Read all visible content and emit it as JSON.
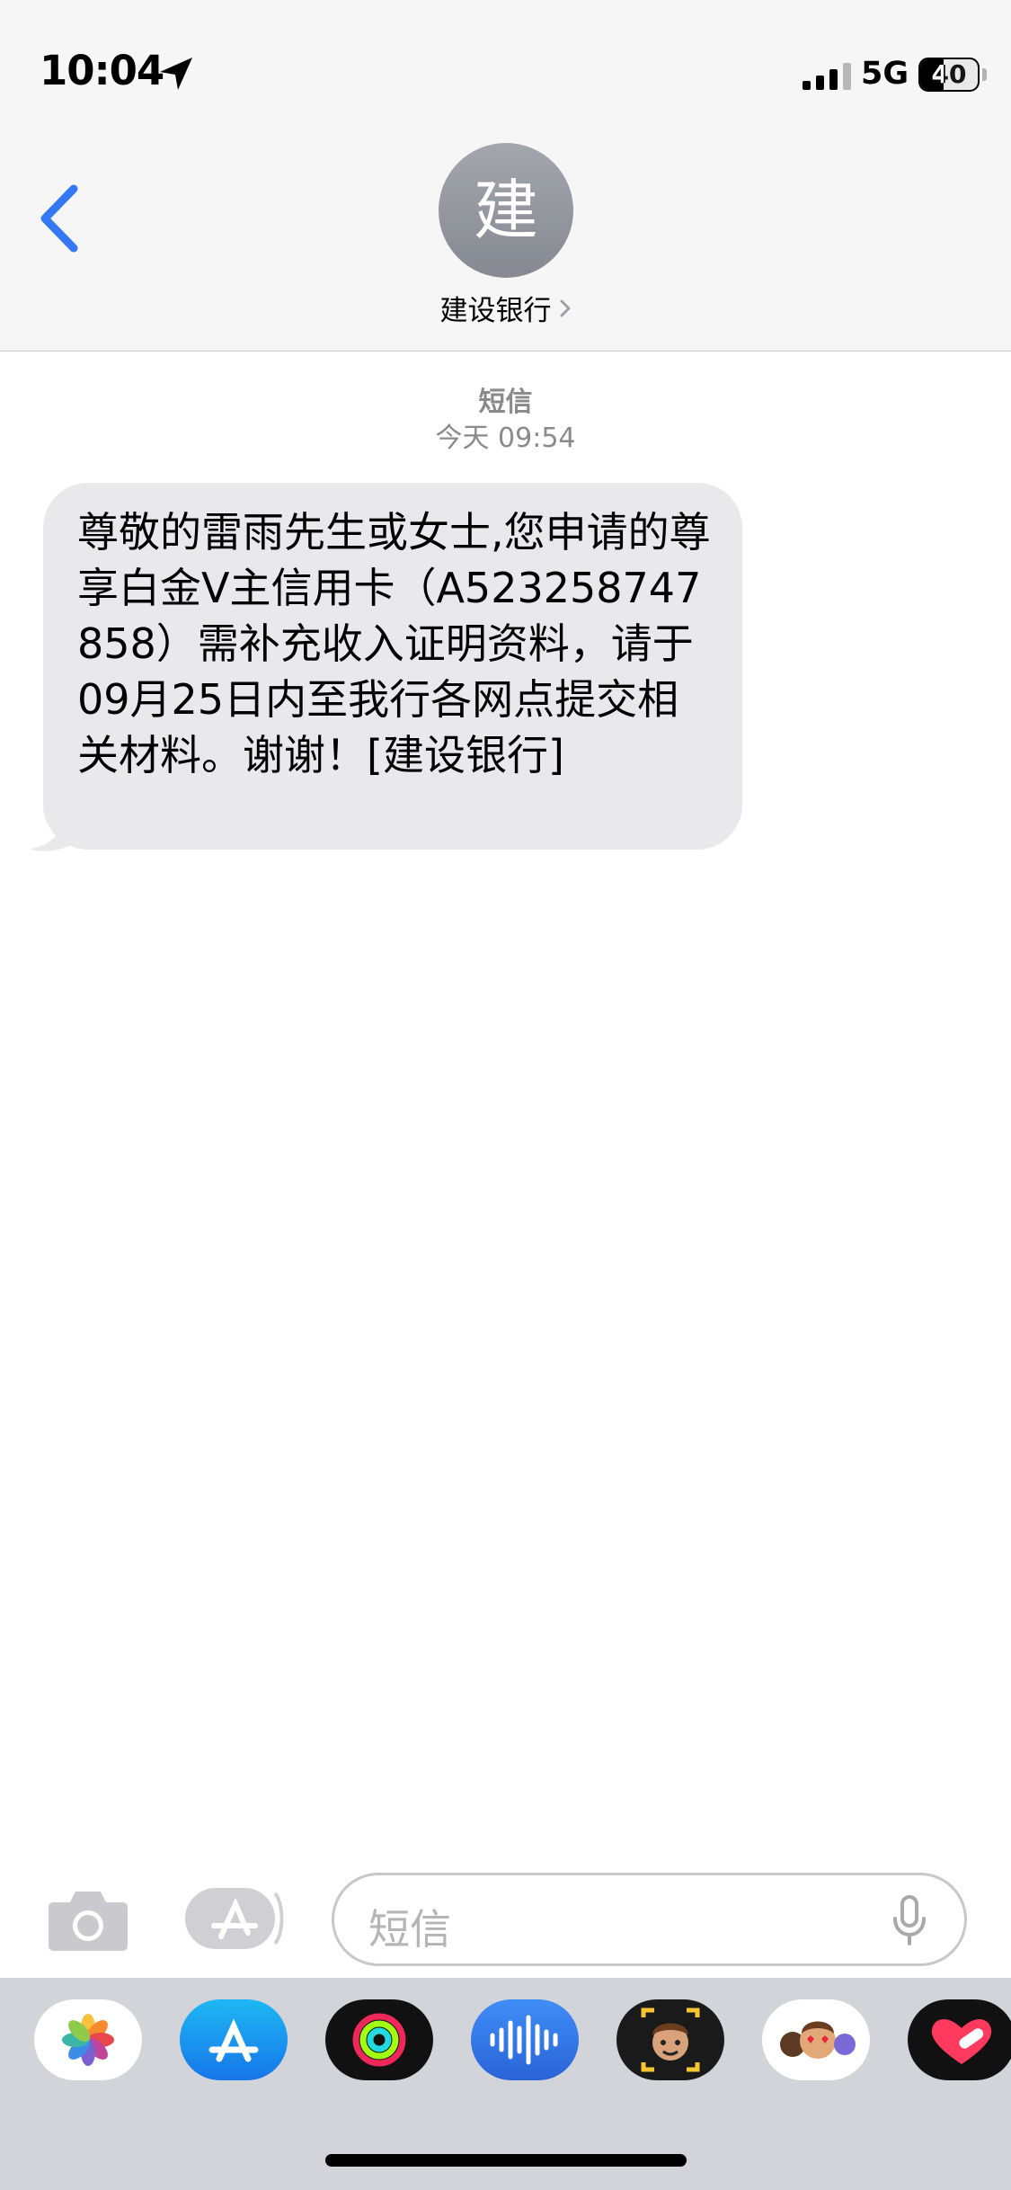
{
  "status_bar": {
    "time": "10:04",
    "network": "5G",
    "battery_percent": 40,
    "battery_label": "40",
    "icons": [
      "location-arrow-icon",
      "cellular-signal-icon",
      "battery-icon"
    ]
  },
  "header": {
    "avatar_initial": "建",
    "contact_name": "建设银行",
    "icons": [
      "back-chevron-icon",
      "chevron-right-icon"
    ]
  },
  "conversation": {
    "service": "短信",
    "timestamp": "今天 09:54",
    "messages": [
      {
        "direction": "incoming",
        "text": "尊敬的雷雨先生或女士,您申请的尊享白金Ⅴ主信用卡（A523258747858）需补充收入证明资料，请于09月25日内至我行各网点提交相关材料。谢谢！[建设银行]"
      }
    ]
  },
  "composer": {
    "placeholder": "短信",
    "icons": [
      "camera-icon",
      "app-store-icon",
      "mic-icon"
    ]
  },
  "app_drawer": {
    "apps": [
      {
        "name": "photos-app-icon"
      },
      {
        "name": "app-store-app-icon"
      },
      {
        "name": "activity-app-icon"
      },
      {
        "name": "audio-message-app-icon"
      },
      {
        "name": "memoji-camera-app-icon"
      },
      {
        "name": "memoji-stickers-app-icon"
      },
      {
        "name": "digital-touch-app-icon"
      }
    ]
  },
  "colors": {
    "accent": "#3478f6",
    "bubble_incoming": "#e9e9eb",
    "bar_background": "#f6f6f6",
    "drawer_background": "#d2d4da",
    "secondary_text": "#8a8a8e"
  }
}
